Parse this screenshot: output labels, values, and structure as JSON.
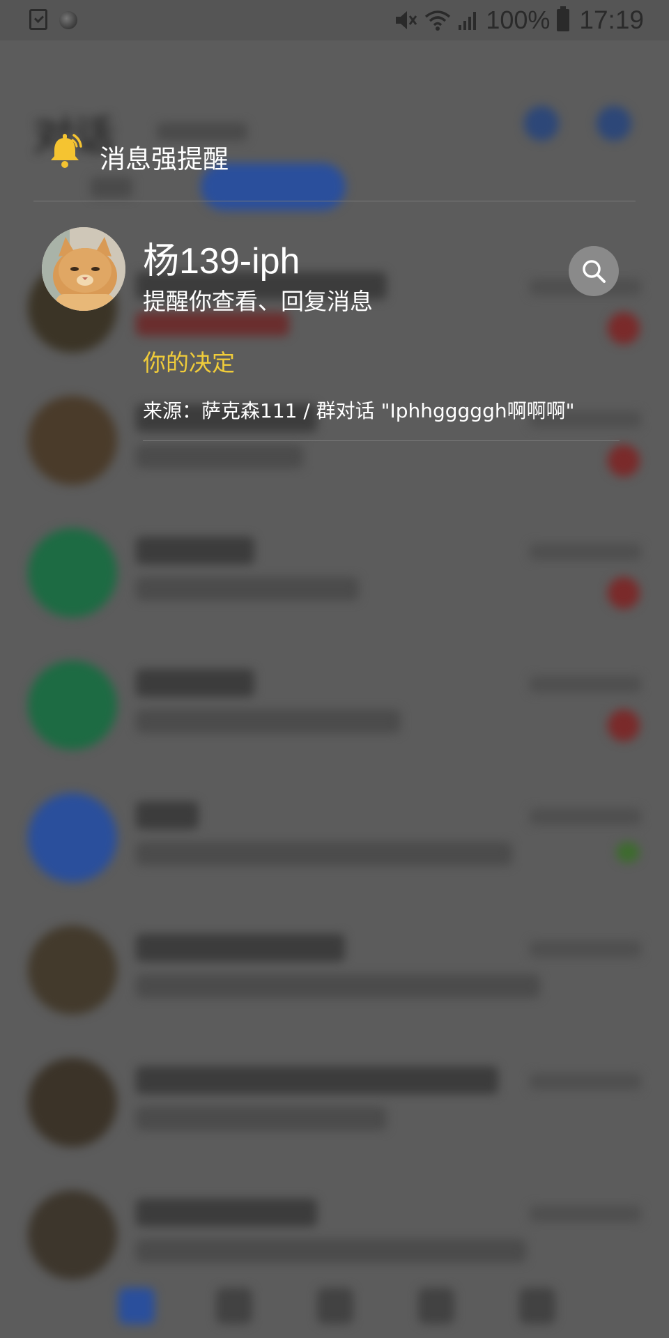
{
  "status_bar": {
    "battery_percent": "100%",
    "time": "17:19",
    "icons": [
      "checklist-icon",
      "circle-icon",
      "mute-icon",
      "wifi-icon",
      "signal-icon",
      "battery-icon"
    ]
  },
  "overlay": {
    "header_title": "消息强提醒",
    "icon": "bell-ringing-icon",
    "accent_color": "#f5c431",
    "card": {
      "sender_name": "杨139-iph",
      "message": "提醒你查看、回复消息",
      "action_text": "你的决定",
      "source": "来源：萨克森111 / 群对话 \"Iphhgggggh啊啊啊\"",
      "search_icon": "search-icon"
    }
  },
  "background": {
    "header_title": "对话"
  }
}
